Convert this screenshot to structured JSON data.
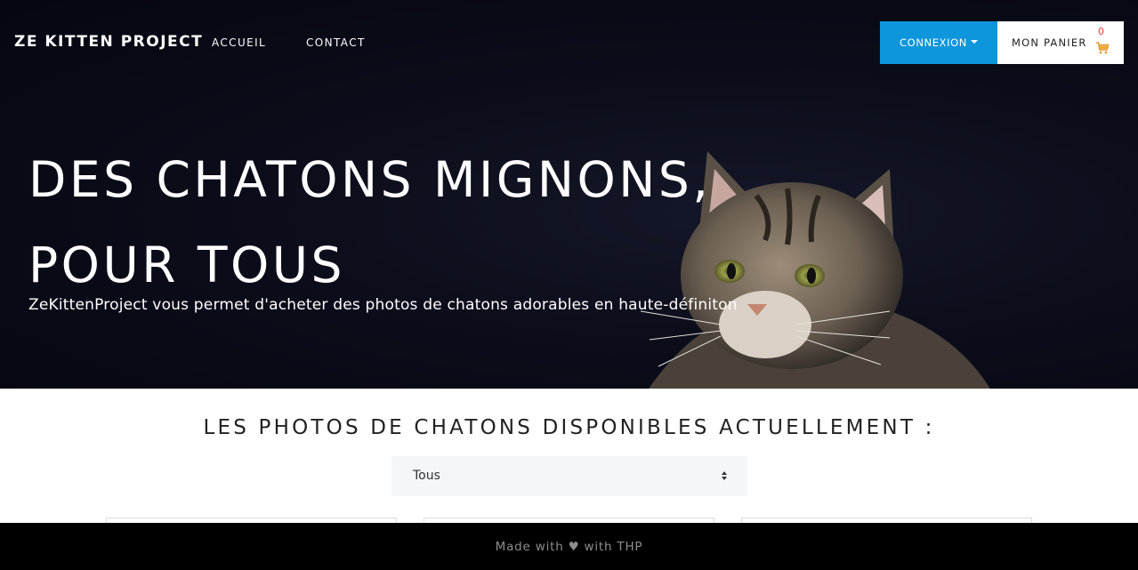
{
  "navbar": {
    "brand": "ZE KITTEN PROJECT",
    "links": [
      "ACCUEIL",
      "CONTACT"
    ],
    "login_label": "CONNEXION",
    "cart_label": "MON PANIER",
    "cart_count": "0"
  },
  "hero": {
    "title_line1": "DES CHATONS MIGNONS,",
    "title_line2": "POUR TOUS",
    "subtitle": "ZeKittenProject vous permet d'acheter des photos de chatons adorables en haute-définiton"
  },
  "section": {
    "title": "LES PHOTOS DE CHATONS DISPONIBLES ACTUELLEMENT :",
    "filter_value": "Tous"
  },
  "footer": {
    "prefix": "Made with",
    "heart": "♥",
    "suffix": "with THP"
  },
  "colors": {
    "accent": "#0d96dc",
    "cart_count": "#e53935",
    "hero_bg": "#0b0d1a",
    "footer_bg": "#000000"
  },
  "icons": [
    "cart-icon",
    "caret-down-icon",
    "select-arrows-icon",
    "heart-icon"
  ]
}
